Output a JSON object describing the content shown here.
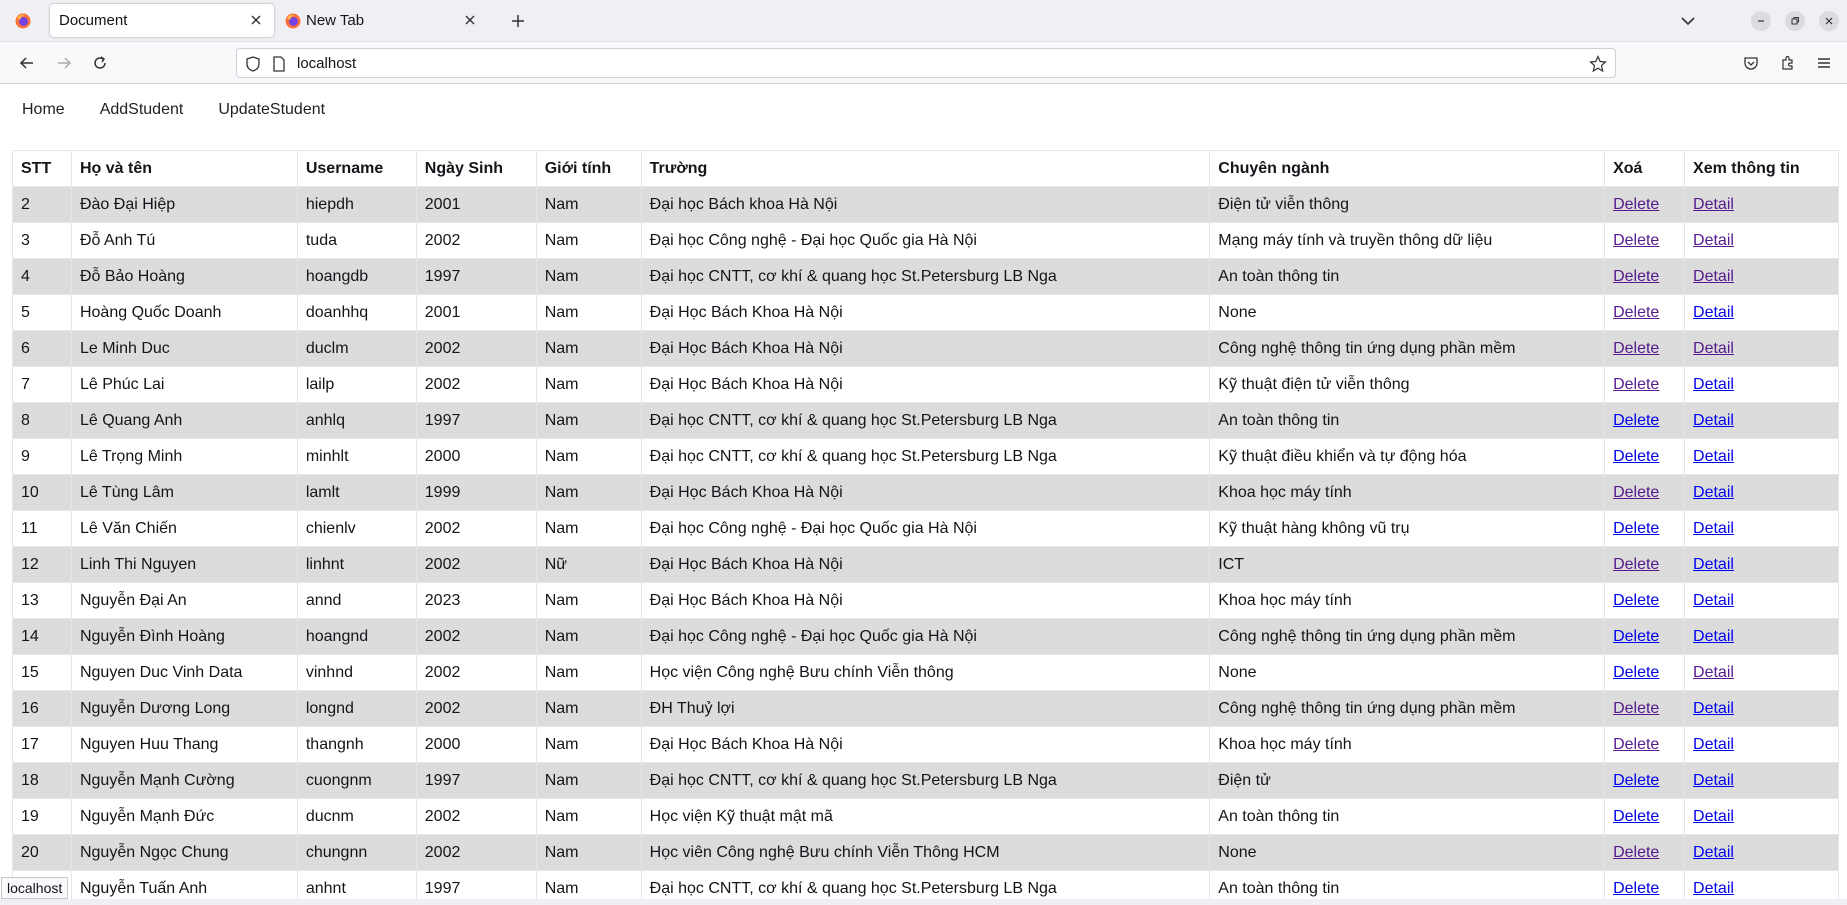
{
  "browser": {
    "tabs": [
      {
        "title": "Document",
        "active": true
      },
      {
        "title": "New Tab",
        "active": false
      }
    ],
    "url": "localhost",
    "status_tooltip": "localhost"
  },
  "nav": {
    "home": "Home",
    "add_student": "AddStudent",
    "update_student": "UpdateStudent"
  },
  "table": {
    "headers": [
      "STT",
      "Họ và tên",
      "Username",
      "Ngày Sinh",
      "Giới tính",
      "Trường",
      "Chuyên ngành",
      "Xoá",
      "Xem thông tin"
    ],
    "rows": [
      {
        "stt": "2",
        "name": "Đào Đại Hiệp",
        "username": "hiepdh",
        "birth": "2001",
        "gender": "Nam",
        "school": "Đại học Bách khoa Hà Nội",
        "major": "Điện tử viễn thông",
        "delete": "Delete",
        "detail": "Detail",
        "del_visited": true,
        "det_visited": true
      },
      {
        "stt": "3",
        "name": "Đỗ Anh Tú",
        "username": "tuda",
        "birth": "2002",
        "gender": "Nam",
        "school": "Đại học Công nghệ - Đại học Quốc gia Hà Nội",
        "major": "Mạng máy tính và truyền thông dữ liệu",
        "delete": "Delete",
        "detail": "Detail",
        "del_visited": true,
        "det_visited": true
      },
      {
        "stt": "4",
        "name": "Đỗ Bảo Hoàng",
        "username": "hoangdb",
        "birth": "1997",
        "gender": "Nam",
        "school": "Đại học CNTT, cơ khí & quang học St.Petersburg LB Nga",
        "major": "An toàn thông tin",
        "delete": "Delete",
        "detail": "Detail",
        "del_visited": true,
        "det_visited": true
      },
      {
        "stt": "5",
        "name": "Hoàng Quốc Doanh",
        "username": "doanhhq",
        "birth": "2001",
        "gender": "Nam",
        "school": "Đại Học Bách Khoa Hà Nội",
        "major": "None",
        "delete": "Delete",
        "detail": "Detail",
        "del_visited": true,
        "det_visited": false
      },
      {
        "stt": "6",
        "name": "Le Minh Duc",
        "username": "duclm",
        "birth": "2002",
        "gender": "Nam",
        "school": "Đại Học Bách Khoa Hà Nội",
        "major": "Công nghệ thông tin ứng dụng phần mềm",
        "delete": "Delete",
        "detail": "Detail",
        "del_visited": true,
        "det_visited": true
      },
      {
        "stt": "7",
        "name": "Lê Phúc Lai",
        "username": "lailp",
        "birth": "2002",
        "gender": "Nam",
        "school": "Đại Học Bách Khoa Hà Nội",
        "major": "Kỹ thuật điện tử viễn thông",
        "delete": "Delete",
        "detail": "Detail",
        "del_visited": true,
        "det_visited": false
      },
      {
        "stt": "8",
        "name": "Lê Quang Anh",
        "username": "anhlq",
        "birth": "1997",
        "gender": "Nam",
        "school": "Đại học CNTT, cơ khí & quang học St.Petersburg LB Nga",
        "major": "An toàn thông tin",
        "delete": "Delete",
        "detail": "Detail",
        "del_visited": false,
        "det_visited": false
      },
      {
        "stt": "9",
        "name": "Lê Trọng Minh",
        "username": "minhlt",
        "birth": "2000",
        "gender": "Nam",
        "school": "Đại học CNTT, cơ khí & quang học St.Petersburg LB Nga",
        "major": "Kỹ thuật điều khiển và tự động hóa",
        "delete": "Delete",
        "detail": "Detail",
        "del_visited": false,
        "det_visited": false
      },
      {
        "stt": "10",
        "name": "Lê Tùng Lâm",
        "username": "lamlt",
        "birth": "1999",
        "gender": "Nam",
        "school": "Đại Học Bách Khoa Hà Nội",
        "major": "Khoa học máy tính",
        "delete": "Delete",
        "detail": "Detail",
        "del_visited": true,
        "det_visited": false
      },
      {
        "stt": "11",
        "name": "Lê Văn Chiến",
        "username": "chienlv",
        "birth": "2002",
        "gender": "Nam",
        "school": "Đại học Công nghệ - Đại học Quốc gia Hà Nội",
        "major": "Kỹ thuật hàng không vũ trụ",
        "delete": "Delete",
        "detail": "Detail",
        "del_visited": false,
        "det_visited": false
      },
      {
        "stt": "12",
        "name": "Linh Thi Nguyen",
        "username": "linhnt",
        "birth": "2002",
        "gender": "Nữ",
        "school": "Đại Học Bách Khoa Hà Nội",
        "major": "ICT",
        "delete": "Delete",
        "detail": "Detail",
        "del_visited": true,
        "det_visited": false
      },
      {
        "stt": "13",
        "name": "Nguyễn Đại An",
        "username": "annd",
        "birth": "2023",
        "gender": "Nam",
        "school": "Đại Học Bách Khoa Hà Nội",
        "major": "Khoa học máy tính",
        "delete": "Delete",
        "detail": "Detail",
        "del_visited": false,
        "det_visited": false
      },
      {
        "stt": "14",
        "name": "Nguyễn Đình Hoàng",
        "username": "hoangnd",
        "birth": "2002",
        "gender": "Nam",
        "school": "Đại học Công nghệ - Đại học Quốc gia Hà Nội",
        "major": "Công nghệ thông tin ứng dụng phần mềm",
        "delete": "Delete",
        "detail": "Detail",
        "del_visited": false,
        "det_visited": false
      },
      {
        "stt": "15",
        "name": "Nguyen Duc Vinh Data",
        "username": "vinhnd",
        "birth": "2002",
        "gender": "Nam",
        "school": "Học viện Công nghệ Bưu chính Viễn thông",
        "major": "None",
        "delete": "Delete",
        "detail": "Detail",
        "del_visited": false,
        "det_visited": true
      },
      {
        "stt": "16",
        "name": "Nguyễn Dương Long",
        "username": "longnd",
        "birth": "2002",
        "gender": "Nam",
        "school": "ĐH Thuỷ lợi",
        "major": "Công nghệ thông tin ứng dụng phần mềm",
        "delete": "Delete",
        "detail": "Detail",
        "del_visited": true,
        "det_visited": false
      },
      {
        "stt": "17",
        "name": "Nguyen Huu Thang",
        "username": "thangnh",
        "birth": "2000",
        "gender": "Nam",
        "school": "Đại Học Bách Khoa Hà Nội",
        "major": "Khoa học máy tính",
        "delete": "Delete",
        "detail": "Detail",
        "del_visited": true,
        "det_visited": false
      },
      {
        "stt": "18",
        "name": "Nguyễn Mạnh Cường",
        "username": "cuongnm",
        "birth": "1997",
        "gender": "Nam",
        "school": "Đại học CNTT, cơ khí & quang học St.Petersburg LB Nga",
        "major": "Điện tử",
        "delete": "Delete",
        "detail": "Detail",
        "del_visited": false,
        "det_visited": false
      },
      {
        "stt": "19",
        "name": "Nguyễn Mạnh Đức",
        "username": "ducnm",
        "birth": "2002",
        "gender": "Nam",
        "school": "Học viện Kỹ thuật mật mã",
        "major": "An toàn thông tin",
        "delete": "Delete",
        "detail": "Detail",
        "del_visited": false,
        "det_visited": false
      },
      {
        "stt": "20",
        "name": "Nguyễn Ngọc Chung",
        "username": "chungnn",
        "birth": "2002",
        "gender": "Nam",
        "school": "Học viên Công nghệ Bưu chính Viễn Thông HCM",
        "major": "None",
        "delete": "Delete",
        "detail": "Detail",
        "del_visited": true,
        "det_visited": false
      },
      {
        "stt": "21",
        "name": "Nguyễn Tuấn Anh",
        "username": "anhnt",
        "birth": "1997",
        "gender": "Nam",
        "school": "Đại học CNTT, cơ khí & quang học St.Petersburg LB Nga",
        "major": "An toàn thông tin",
        "delete": "Delete",
        "detail": "Detail",
        "del_visited": false,
        "det_visited": false
      }
    ]
  },
  "colors": {
    "link": "#0000ee",
    "visited_link": "#551a8b",
    "striped_row": "#dcdcdc"
  }
}
